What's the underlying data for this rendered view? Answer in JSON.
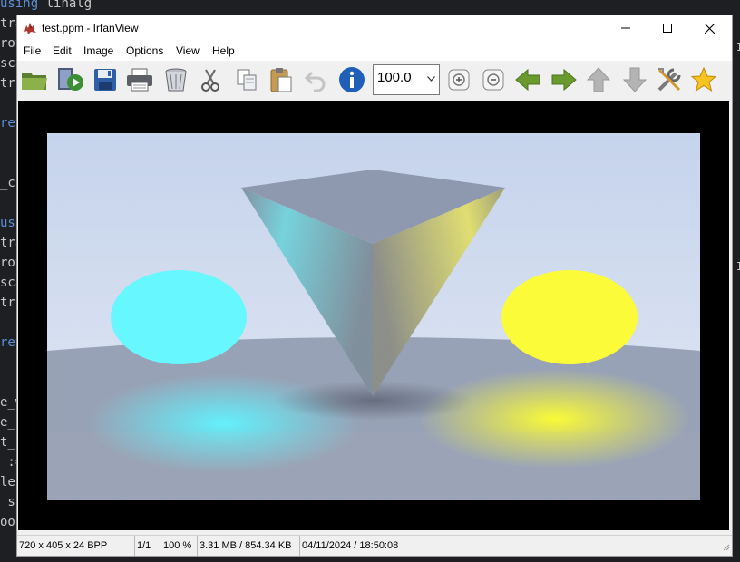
{
  "background_code": {
    "lines": [
      {
        "kw": "using",
        "rest": " linalg"
      },
      {
        "kw": "",
        "rest": "tra"
      },
      {
        "kw": "",
        "rest": "rot"
      },
      {
        "kw": "",
        "rest": "sca"
      },
      {
        "kw": "",
        "rest": "trs"
      },
      {
        "kw": "",
        "rest": ""
      },
      {
        "kw": "ret",
        "rest": ""
      },
      {
        "kw": "",
        "rest": ""
      },
      {
        "kw": "",
        "rest": ""
      },
      {
        "kw": "",
        "rest": "_cu"
      },
      {
        "kw": "",
        "rest": ""
      },
      {
        "kw": "usi",
        "rest": ""
      },
      {
        "kw": "",
        "rest": "tra"
      },
      {
        "kw": "",
        "rest": "rot"
      },
      {
        "kw": "",
        "rest": "sca"
      },
      {
        "kw": "",
        "rest": "trs"
      },
      {
        "kw": "",
        "rest": ""
      },
      {
        "kw": "ret",
        "rest": ""
      },
      {
        "kw": "",
        "rest": ""
      },
      {
        "kw": "",
        "rest": ""
      },
      {
        "kw": "",
        "rest": "e_w"
      },
      {
        "kw": "",
        "rest": "e_h"
      },
      {
        "kw": "",
        "rest": "t_"
      },
      {
        "kw": "",
        "rest": " :="
      },
      {
        "kw": "",
        "rest": "les"
      },
      {
        "kw": "",
        "rest": "_s"
      },
      {
        "kw": "",
        "rest": "oou"
      }
    ],
    "right_marks": [
      "I",
      "I"
    ]
  },
  "window": {
    "title": "test.ppm - IrfanView",
    "controls": {
      "minimize": "—",
      "maximize": "☐",
      "close": "✕"
    }
  },
  "menu": [
    "File",
    "Edit",
    "Image",
    "Options",
    "View",
    "Help"
  ],
  "toolbar": {
    "buttons": [
      "open-icon",
      "slideshow-icon",
      "save-icon",
      "print-icon",
      "delete-icon",
      "cut-icon",
      "copy-icon",
      "paste-icon",
      "undo-icon",
      "info-icon"
    ],
    "zoom_value": "100.0",
    "buttons_after": [
      "zoom-in-icon",
      "zoom-out-icon",
      "previous-icon",
      "next-icon",
      "up-icon",
      "down-icon",
      "properties-icon",
      "favorite-icon"
    ]
  },
  "colors": {
    "sky_top": "#c5d3ec",
    "sky_bottom": "#e3e9f3",
    "floor": "#98a2b6",
    "cyan": "#66f7ff",
    "yellow": "#fcfb3a",
    "cube": "#8e98ae"
  },
  "status": {
    "dimensions": "720 x 405 x 24 BPP",
    "page": "1/1",
    "zoom": "100 %",
    "size": "3.31 MB / 854.34 KB",
    "datetime": "04/11/2024 / 18:50:08"
  }
}
